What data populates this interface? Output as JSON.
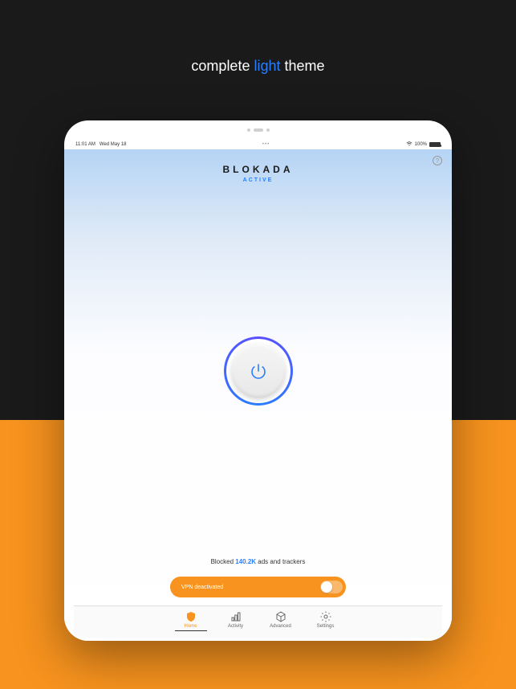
{
  "heading": {
    "pre": "complete",
    "accent": "light",
    "post": "theme"
  },
  "status": {
    "time": "11:01 AM",
    "date": "Wed May 18",
    "center": "•••",
    "battery": "100%"
  },
  "brand": {
    "name": "BLOKADA",
    "status": "ACTIVE"
  },
  "blocked": {
    "prefix": "Blocked ",
    "count": "140.2K",
    "suffix": " ads and trackers"
  },
  "vpn": {
    "label": "VPN deactivated"
  },
  "tabs": [
    {
      "label": "Home"
    },
    {
      "label": "Activity"
    },
    {
      "label": "Advanced"
    },
    {
      "label": "Settings"
    }
  ]
}
